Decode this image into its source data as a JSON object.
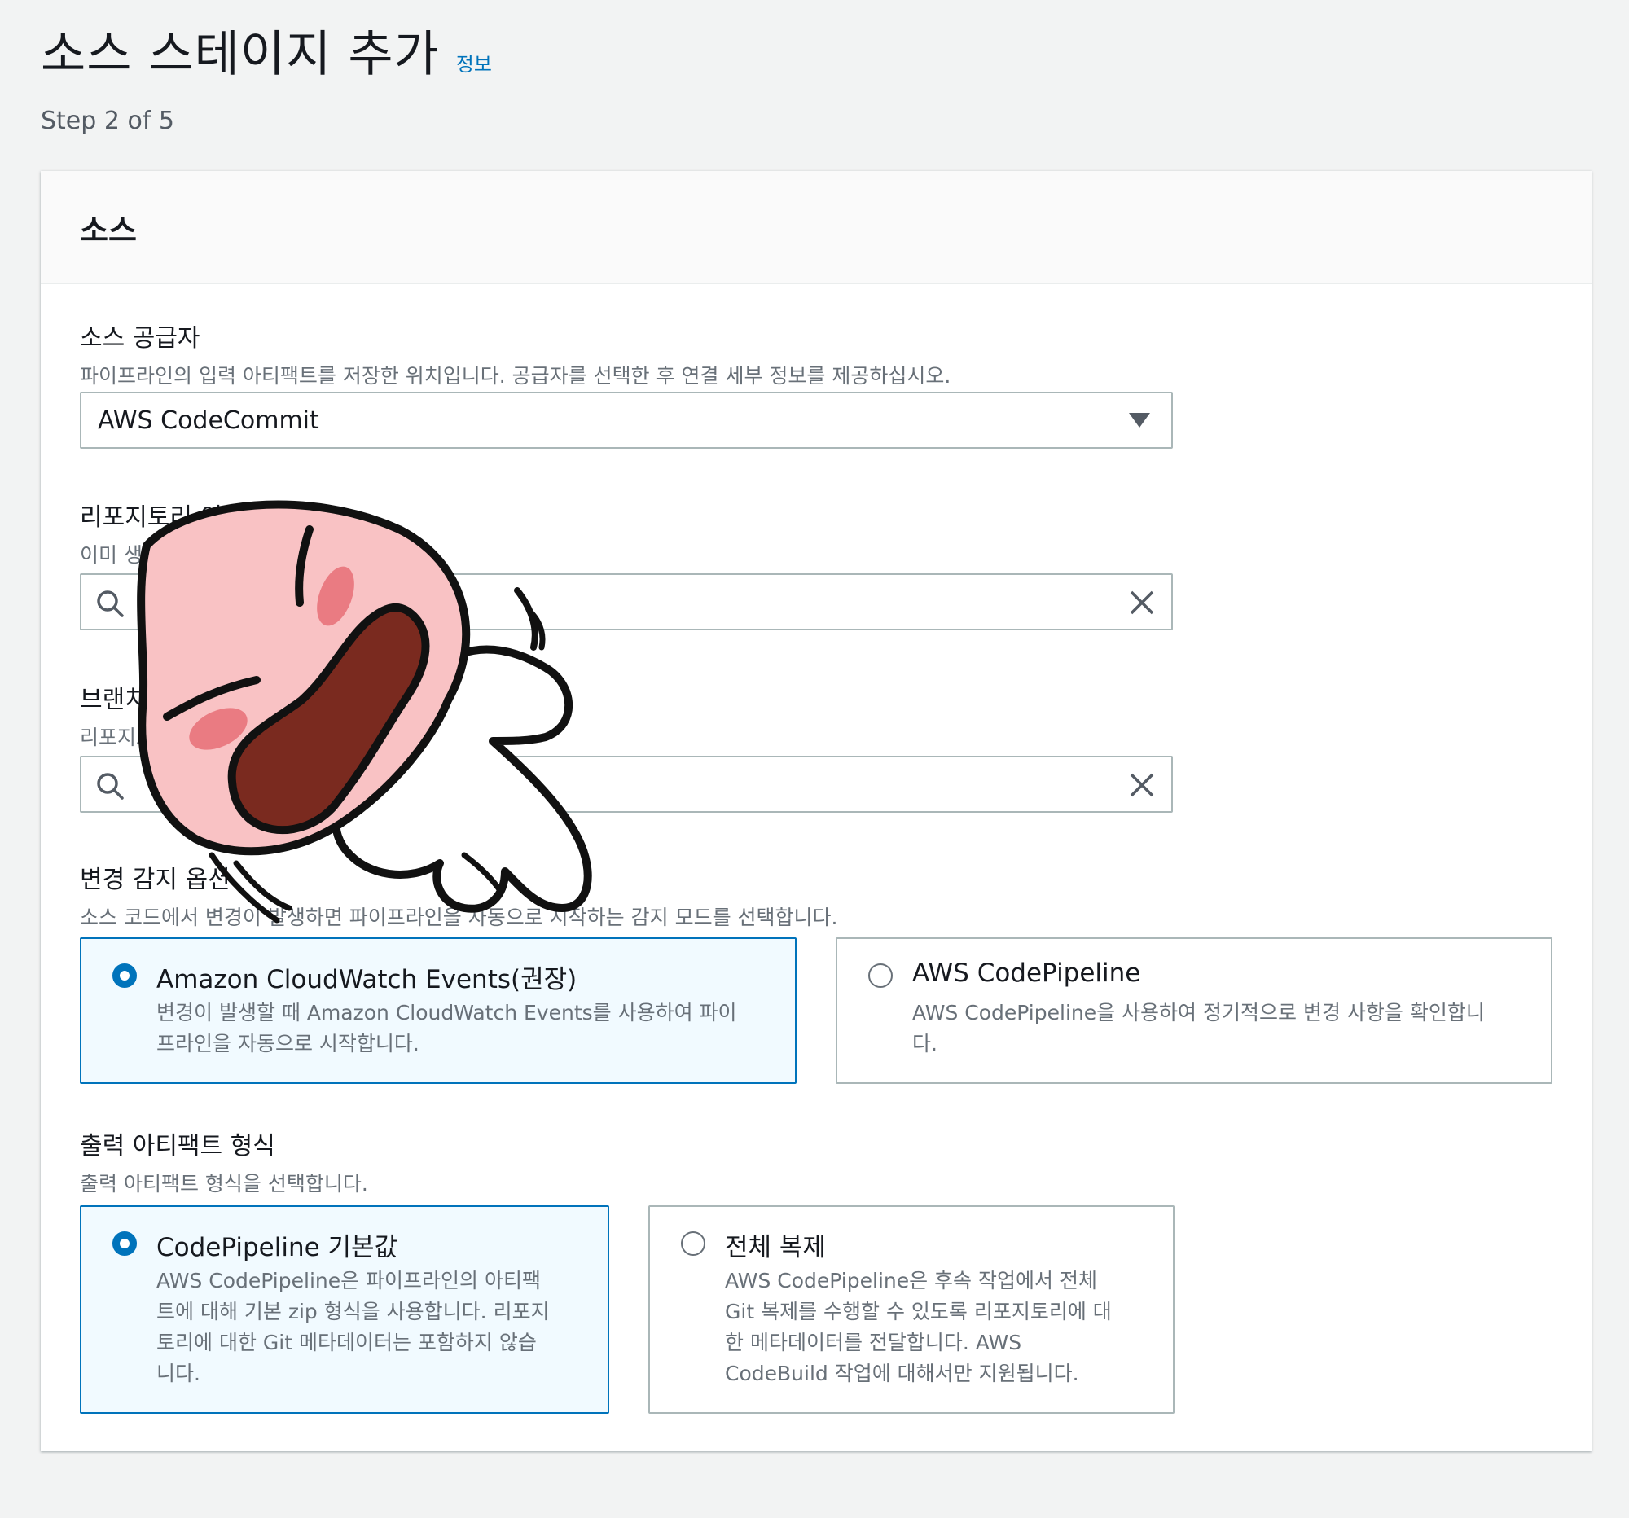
{
  "header": {
    "title": "소스 스테이지 추가",
    "info_link": "정보",
    "step": "Step 2 of 5"
  },
  "panel": {
    "title": "소스",
    "source_provider": {
      "label": "소스 공급자",
      "description": "파이프라인의 입력 아티팩트를 저장한 위치입니다. 공급자를 선택한 후 연결 세부 정보를 제공하십시오.",
      "selected": "AWS CodeCommit"
    },
    "repository": {
      "label": "리포지토리 이름",
      "description": "이미 생성한 리포지토리를 선택합니다.",
      "value": ""
    },
    "branch": {
      "label": "브랜치 이름",
      "description": "리포지토리의 브랜치를 선택합니다.",
      "value": ""
    },
    "change_detection": {
      "label": "변경 감지 옵션",
      "description": "소스 코드에서 변경이 발생하면 파이프라인을 자동으로 시작하는 감지 모드를 선택합니다.",
      "options": [
        {
          "title": "Amazon CloudWatch Events(권장)",
          "desc1": "변경이 발생할 때 Amazon CloudWatch Events를 사용하여 파이",
          "desc2": "프라인을 자동으로 시작합니다.",
          "checked": true
        },
        {
          "title": "AWS CodePipeline",
          "desc1": "AWS CodePipeline을 사용하여 정기적으로 변경 사항을 확인합니",
          "desc2": "다.",
          "checked": false
        }
      ]
    },
    "output_format": {
      "label": "출력 아티팩트 형식",
      "description": "출력 아티팩트 형식을 선택합니다.",
      "options": [
        {
          "title": "CodePipeline 기본값",
          "lines": [
            "AWS CodePipeline은 파이프라인의 아티팩",
            "트에 대해 기본 zip 형식을 사용합니다. 리포지",
            "토리에 대한 Git 메타데이터는 포함하지 않습",
            "니다."
          ],
          "checked": true
        },
        {
          "title": "전체 복제",
          "lines": [
            "AWS CodePipeline은 후속 작업에서 전체",
            "Git 복제를 수행할 수 있도록 리포지토리에 대",
            "한 메타데이터를 전달합니다. AWS",
            "CodeBuild 작업에 대해서만 지원됩니다."
          ],
          "checked": false
        }
      ]
    }
  },
  "colors": {
    "accent": "#0073bb",
    "selected_tile_bg": "#f1faff",
    "page_bg": "#f2f3f3"
  }
}
